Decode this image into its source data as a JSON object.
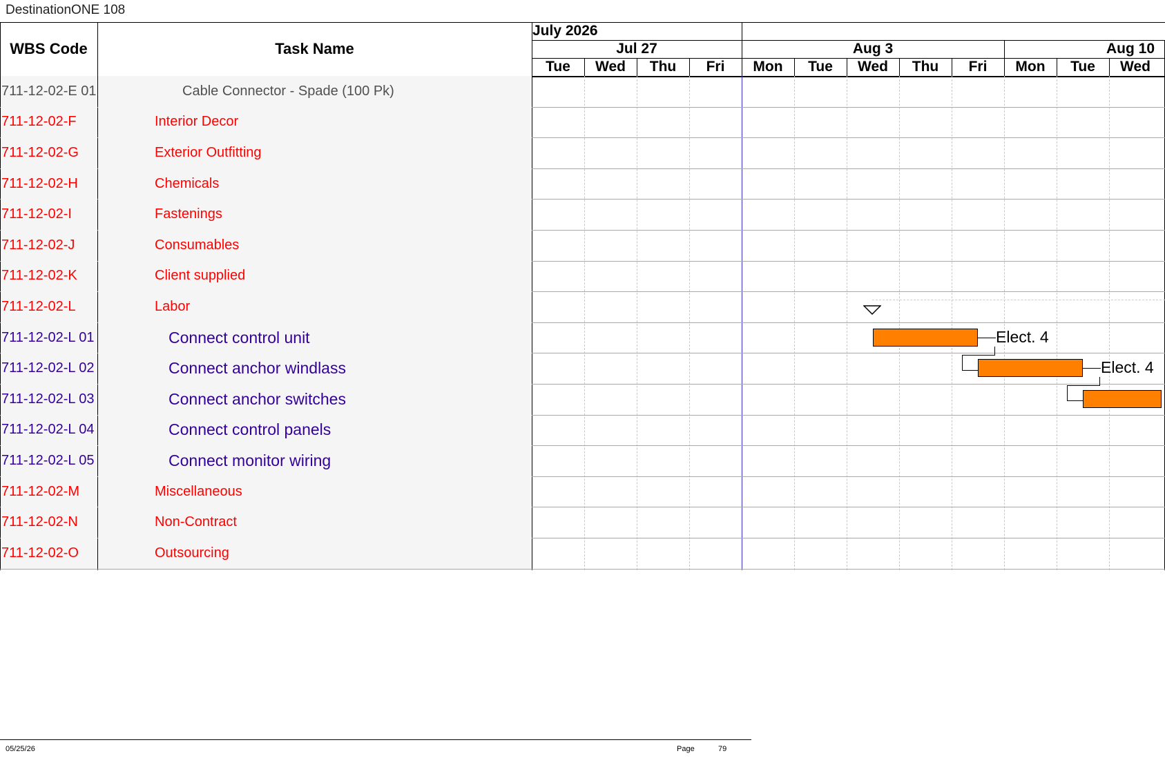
{
  "app": {
    "title": "DestinationONE 108"
  },
  "header": {
    "wbs_label": "WBS Code",
    "task_label": "Task Name",
    "month": "July 2026",
    "weeks": [
      "Jul 27",
      "Aug 3",
      "Aug 10"
    ],
    "days": [
      "Tue",
      "Wed",
      "Thu",
      "Fri",
      "Mon",
      "Tue",
      "Wed",
      "Thu",
      "Fri",
      "Mon",
      "Tue",
      "Wed"
    ]
  },
  "colors": {
    "summary": "#ff0000",
    "task": "#330099",
    "cost_item": "#505050",
    "bar": "#ff8000",
    "today_line": "#3333cc"
  },
  "rows": [
    {
      "wbs": "711-12-02-E 01",
      "name": "Cable Connector - Spade  (100 Pk)",
      "kind": "cost_item"
    },
    {
      "wbs": "711-12-02-F",
      "name": "Interior Decor",
      "kind": "summary"
    },
    {
      "wbs": "711-12-02-G",
      "name": "Exterior Outfitting",
      "kind": "summary"
    },
    {
      "wbs": "711-12-02-H",
      "name": "Chemicals",
      "kind": "summary"
    },
    {
      "wbs": "711-12-02-I",
      "name": "Fastenings",
      "kind": "summary"
    },
    {
      "wbs": "711-12-02-J",
      "name": "Consumables",
      "kind": "summary"
    },
    {
      "wbs": "711-12-02-K",
      "name": "Client supplied",
      "kind": "summary"
    },
    {
      "wbs": "711-12-02-L",
      "name": "Labor",
      "kind": "summary"
    },
    {
      "wbs": "711-12-02-L 01",
      "name": "Connect control unit",
      "kind": "task",
      "resource": "Elect. 4"
    },
    {
      "wbs": "711-12-02-L 02",
      "name": "Connect anchor windlass",
      "kind": "task",
      "resource": "Elect. 4"
    },
    {
      "wbs": "711-12-02-L 03",
      "name": "Connect anchor switches",
      "kind": "task"
    },
    {
      "wbs": "711-12-02-L 04",
      "name": "Connect control panels",
      "kind": "task"
    },
    {
      "wbs": "711-12-02-L 05",
      "name": "Connect monitor wiring",
      "kind": "task"
    },
    {
      "wbs": "711-12-02-M",
      "name": "Miscellaneous",
      "kind": "summary"
    },
    {
      "wbs": "711-12-02-N",
      "name": "Non-Contract",
      "kind": "summary"
    },
    {
      "wbs": "711-12-02-O",
      "name": "Outsourcing",
      "kind": "summary"
    }
  ],
  "footer": {
    "date": "05/25/26",
    "page_label": "Page",
    "page_number": "79"
  }
}
